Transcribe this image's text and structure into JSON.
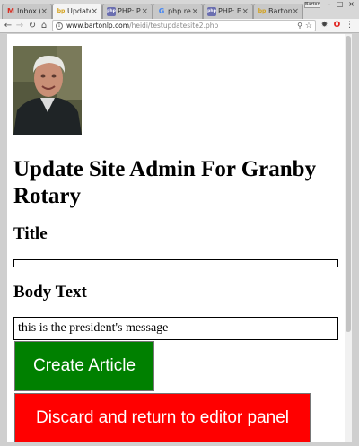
{
  "browser": {
    "tabs": [
      {
        "label": "Inbox (",
        "favicon": "M",
        "favicon_color": "#d93025",
        "favicon_name": "gmail-icon"
      },
      {
        "label": "Update",
        "favicon": "bp",
        "favicon_color": "#d4a017",
        "favicon_name": "bartonlp-favicon-icon",
        "active": true
      },
      {
        "label": "PHP: P",
        "favicon": "php",
        "favicon_color": "#6b6fb0",
        "favicon_name": "php-favicon-icon"
      },
      {
        "label": "php re",
        "favicon": "G",
        "favicon_color": "#4285f4",
        "favicon_name": "google-icon"
      },
      {
        "label": "PHP: E",
        "favicon": "php",
        "favicon_color": "#6b6fb0",
        "favicon_name": "php-favicon-icon"
      },
      {
        "label": "Barton",
        "favicon": "bp",
        "favicon_color": "#d4a017",
        "favicon_name": "bartonlp-favicon-icon"
      }
    ],
    "tab_close_glyph": "×",
    "profile_label": "Barton",
    "url_domain": "www.bartonlp.com",
    "url_path": "/heidi/testupdatesite2.php"
  },
  "page": {
    "title": "Update Site Admin For Granby Rotary",
    "title_heading": "Title",
    "title_value": "",
    "body_heading": "Body Text",
    "body_value": "this is the president's message",
    "create_button": "Create Article",
    "discard_button": "Discard and return to editor panel"
  },
  "colors": {
    "create": "#008000",
    "discard": "#ff0000"
  }
}
